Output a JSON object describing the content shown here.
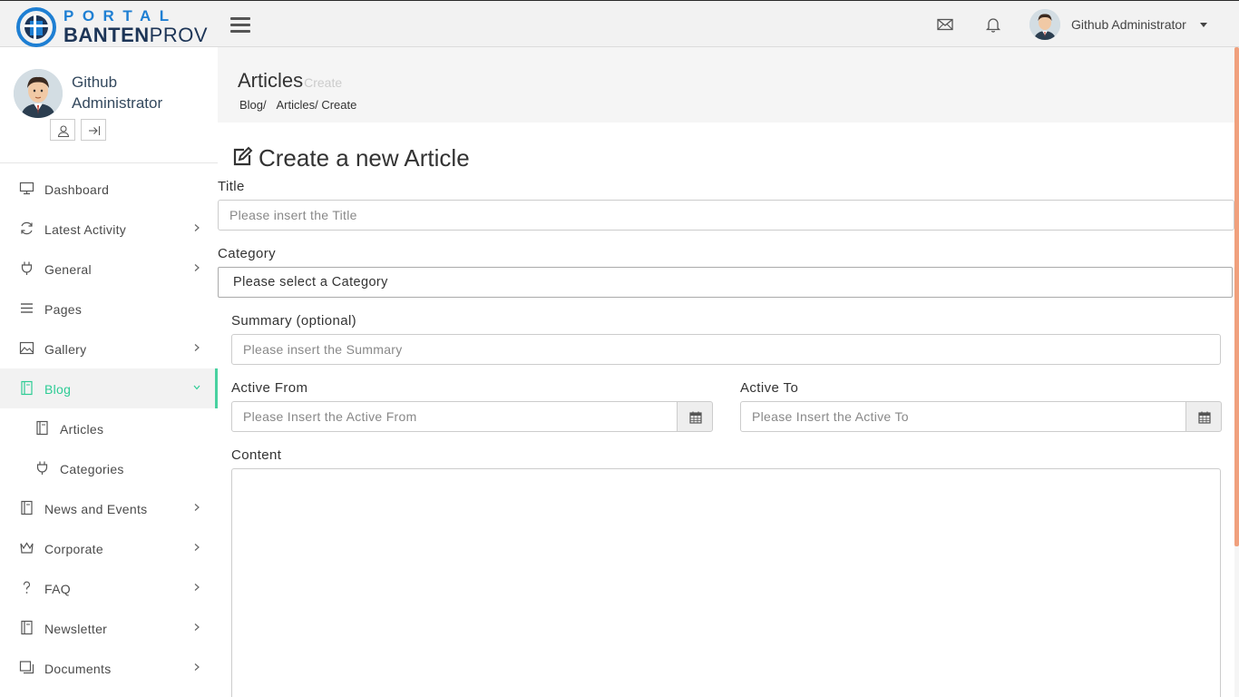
{
  "brand": {
    "line1": "PORTAL",
    "line2a": "BANTEN",
    "line2b": "PROV"
  },
  "topbar": {
    "user_name": "Github Administrator"
  },
  "profile": {
    "name": "Github Administrator"
  },
  "menu": {
    "dashboard": "Dashboard",
    "latest_activity": "Latest Activity",
    "general": "General",
    "pages": "Pages",
    "gallery": "Gallery",
    "blog": "Blog",
    "articles": "Articles",
    "categories": "Categories",
    "news_events": "News and Events",
    "corporate": "Corporate",
    "faq": "FAQ",
    "newsletter": "Newsletter",
    "documents": "Documents"
  },
  "header": {
    "title": "Articles",
    "subtitle": "Create",
    "breadcrumb": [
      "Blog/",
      "Articles/ Create"
    ]
  },
  "form": {
    "heading": "Create a new Article",
    "title_label": "Title",
    "title_placeholder": "Please insert the Title",
    "category_label": "Category",
    "category_value": "Please select a Category",
    "summary_label": "Summary (optional)",
    "summary_placeholder": "Please insert the Summary",
    "active_from_label": "Active From",
    "active_from_placeholder": "Please Insert the Active From",
    "active_to_label": "Active To",
    "active_to_placeholder": "Please Insert the Active To",
    "content_label": "Content"
  },
  "colors": {
    "accent": "#2ecc95",
    "scroll": "#f0a07d",
    "brand_blue": "#1e7fd3"
  }
}
